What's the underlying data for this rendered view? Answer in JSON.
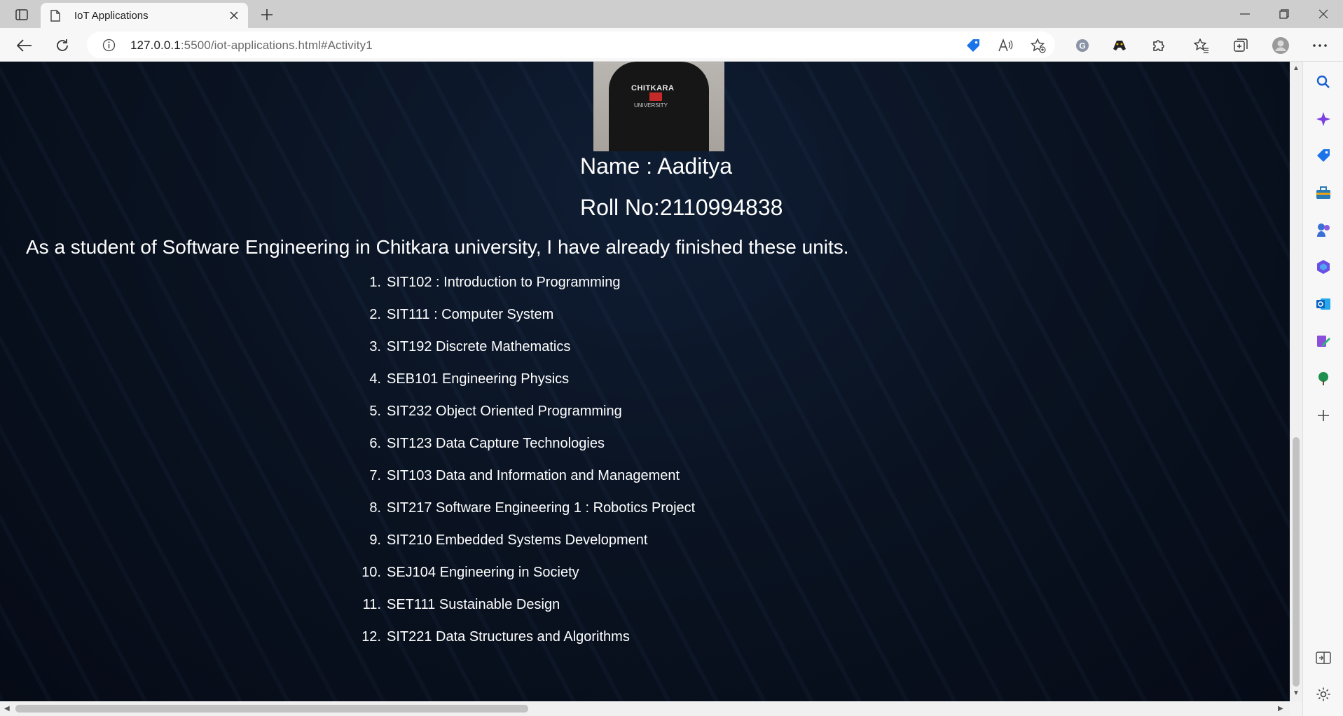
{
  "browser": {
    "tab_title": "IoT Applications",
    "url_host": "127.0.0.1",
    "url_rest": ":5500/iot-applications.html#Activity1"
  },
  "profile": {
    "name_line": "Name : Aaditya",
    "roll_line": "Roll No:2110994838",
    "photo_logo_text": "CHITKARA",
    "photo_logo_sub": "UNIVERSITY"
  },
  "intro": "As a student of Software Engineering in Chitkara university, I have already finished these units.",
  "units": [
    {
      "num": "1.",
      "text": "SIT102 : Introduction to Programming"
    },
    {
      "num": "2.",
      "text": "SIT111 : Computer System"
    },
    {
      "num": "3.",
      "text": "SIT192 Discrete Mathematics"
    },
    {
      "num": "4.",
      "text": "SEB101 Engineering Physics"
    },
    {
      "num": "5.",
      "text": "SIT232 Object Oriented Programming"
    },
    {
      "num": "6.",
      "text": "SIT123 Data Capture Technologies"
    },
    {
      "num": "7.",
      "text": "SIT103 Data and Information and Management"
    },
    {
      "num": "8.",
      "text": "SIT217 Software Engineering 1 : Robotics Project"
    },
    {
      "num": "9.",
      "text": "SIT210 Embedded Systems Development"
    },
    {
      "num": "10.",
      "text": "SEJ104 Engineering in Society"
    },
    {
      "num": "11.",
      "text": "SET111 Sustainable Design"
    },
    {
      "num": "12.",
      "text": "SIT221 Data Structures and Algorithms"
    }
  ],
  "colors": {
    "page_background": "#0a1322",
    "text": "#ffffff",
    "browser_chrome": "#f7f7f7",
    "tab_strip": "#cecece"
  },
  "icons": {
    "sidebar": [
      "search-icon",
      "copilot-icon",
      "tag-icon",
      "toolbox-icon",
      "games-icon",
      "office-icon",
      "outlook-icon",
      "designer-icon",
      "tree-icon",
      "add-icon",
      "split-screen-icon",
      "settings-icon"
    ]
  }
}
